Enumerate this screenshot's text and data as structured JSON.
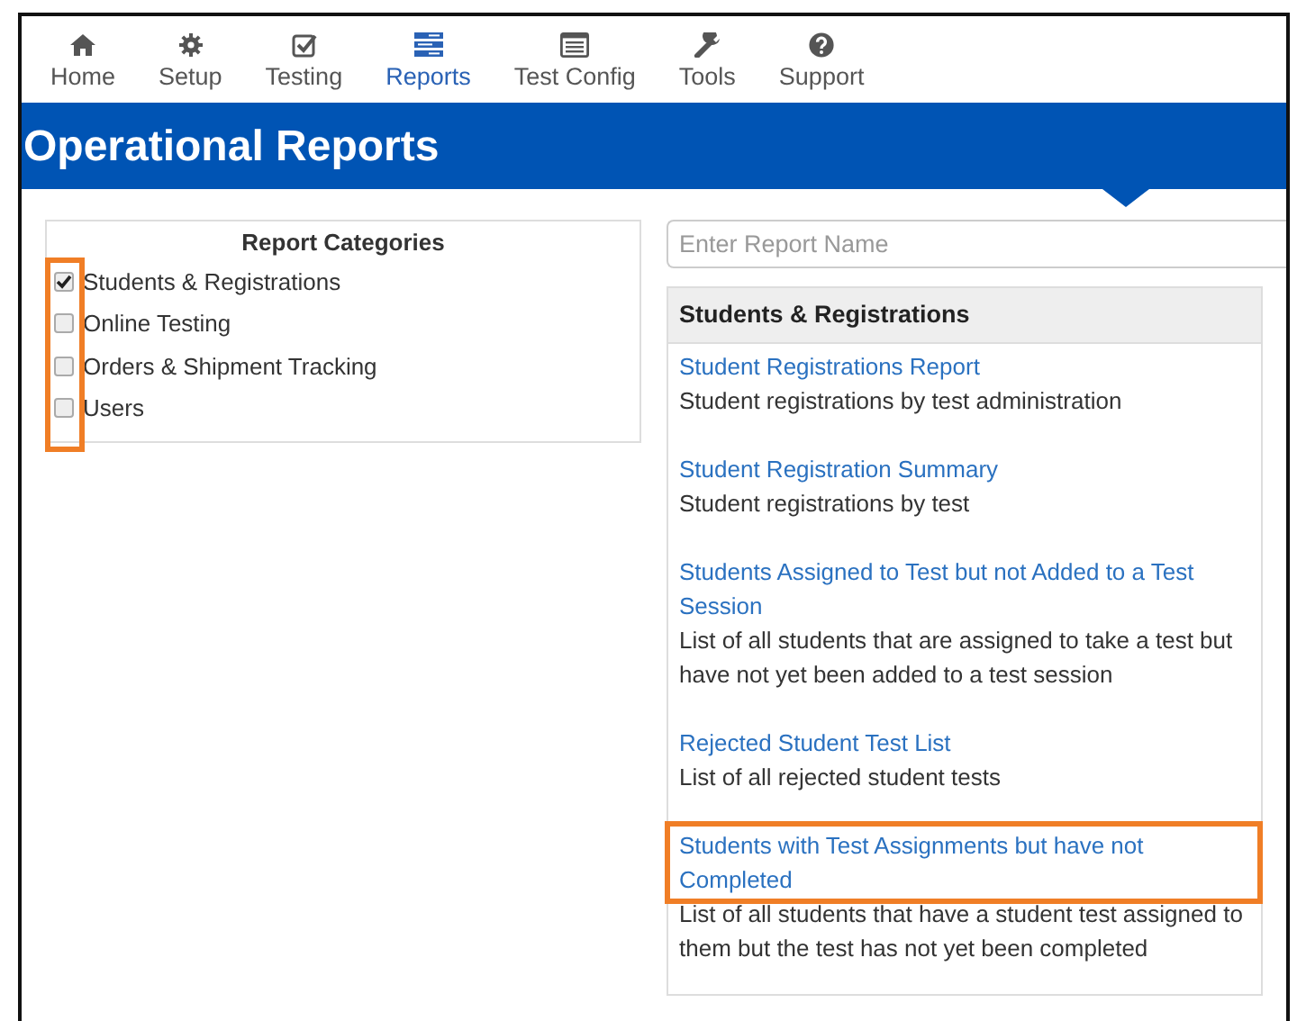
{
  "nav": [
    {
      "label": "Home",
      "selected": false
    },
    {
      "label": "Setup",
      "selected": false
    },
    {
      "label": "Testing",
      "selected": false
    },
    {
      "label": "Reports",
      "selected": true
    },
    {
      "label": "Test Config",
      "selected": false
    },
    {
      "label": "Tools",
      "selected": false
    },
    {
      "label": "Support",
      "selected": false
    }
  ],
  "page_title": "Operational Reports",
  "categories": {
    "title": "Report Categories",
    "checkboxes_highlighted": true,
    "items": [
      {
        "label": "Students & Registrations",
        "checked": true
      },
      {
        "label": "Online Testing",
        "checked": false
      },
      {
        "label": "Orders & Shipment Tracking",
        "checked": false
      },
      {
        "label": "Users",
        "checked": false
      }
    ]
  },
  "search": {
    "placeholder": "Enter Report Name"
  },
  "reports": {
    "title": "Students & Registrations",
    "items": [
      {
        "name": "Student Registrations Report",
        "description": "Student registrations by test administration",
        "highlighted": false
      },
      {
        "name": "Student Registration Summary",
        "description": "Student registrations by test",
        "highlighted": false
      },
      {
        "name": "Students Assigned to Test but not Added to a Test Session",
        "description": "List of all students that are assigned to take a test but have not yet been added to a test session",
        "highlighted": false
      },
      {
        "name": "Rejected Student Test List",
        "description": "List of all rejected student tests",
        "highlighted": false
      },
      {
        "name": "Students with Test Assignments but have not Completed",
        "description": "List of all students that have a student test assigned to them but the test has not yet been completed",
        "highlighted": true
      }
    ]
  }
}
